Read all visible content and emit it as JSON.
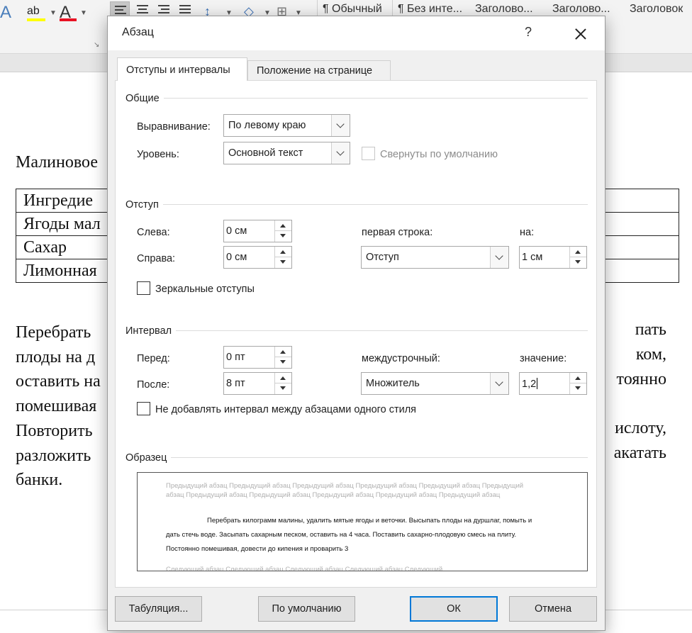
{
  "ribbon": {
    "font_color_glyph": "A",
    "highlight_glyph": "ab",
    "styles": [
      "¶ Обычный",
      "¶ Без инте...",
      "Заголово...",
      "Заголово...",
      "Заголовок"
    ]
  },
  "document": {
    "title_fragment": "Малиновое",
    "table_rows": [
      "Ингредие",
      "Ягоды мал",
      "Сахар",
      "Лимонная"
    ],
    "paragraph_left": [
      "Перебрать",
      "плоды на д",
      "оставить на",
      "помешивая",
      "Повторить",
      "разложить",
      "банки."
    ],
    "paragraph_right": [
      "пать",
      "ком,",
      "тоянно",
      "",
      "ислоту,",
      "акатать",
      ""
    ]
  },
  "dialog": {
    "title": "Абзац",
    "help": "?",
    "tabs": {
      "indents": "Отступы и интервалы",
      "position": "Положение на странице"
    },
    "general": {
      "label": "Общие",
      "alignment_label": "Выравнивание:",
      "alignment_value": "По левому краю",
      "level_label": "Уровень:",
      "level_value": "Основной текст",
      "collapsed_label": "Свернуты по умолчанию"
    },
    "indent": {
      "label": "Отступ",
      "left_label": "Слева:",
      "left_value": "0 см",
      "right_label": "Справа:",
      "right_value": "0 см",
      "first_line_label": "первая строка:",
      "first_line_value": "Отступ",
      "by_label": "на:",
      "by_value": "1 см",
      "mirror_label": "Зеркальные отступы"
    },
    "spacing": {
      "label": "Интервал",
      "before_label": "Перед:",
      "before_value": "0 пт",
      "after_label": "После:",
      "after_value": "8 пт",
      "line_label": "междустрочный:",
      "line_value": "Множитель",
      "at_label": "значение:",
      "at_value": "1,2",
      "no_space_label": "Не добавлять интервал между абзацами одного стиля"
    },
    "preview": {
      "label": "Образец",
      "prev_text": "Предыдущий абзац Предыдущий абзац Предыдущий абзац Предыдущий абзац Предыдущий абзац Предыдущий абзац Предыдущий абзац Предыдущий абзац Предыдущий абзац Предыдущий абзац Предыдущий абзац",
      "cur_line1": "Перебрать килограмм малины, удалить мятые ягоды и веточки. Высыпать плоды на дуршлаг, помыть и",
      "cur_line2": "дать стечь воде. Засыпать сахарным песком, оставить на 4 часа. Поставить сахарно-плодовую смесь на плиту.",
      "cur_line3": "Постоянно помешивая, довести до кипения и проварить 3",
      "next_text": "Следующий абзац Следующий абзац Следующий абзац Следующий абзац Следующий"
    },
    "buttons": {
      "tabs": "Табуляция...",
      "default": "По умолчанию",
      "ok": "ОК",
      "cancel": "Отмена"
    }
  },
  "colors": {
    "accent": "#0078d7",
    "font_color": "#e81123",
    "highlight": "#ffff00",
    "dialog_bg": "#f0f0f0"
  }
}
